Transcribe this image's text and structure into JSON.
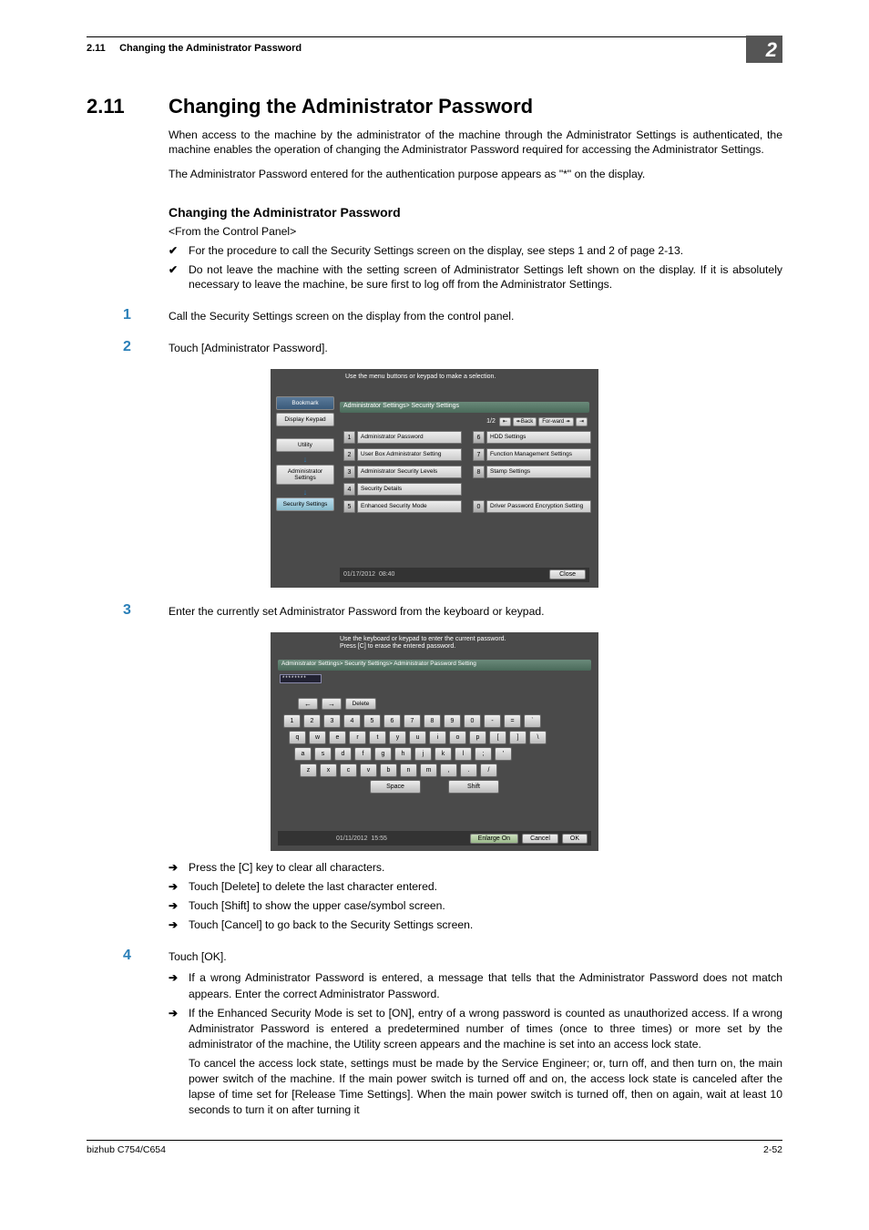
{
  "header": {
    "section_ref": "2.11",
    "section_name": "Changing the Administrator Password",
    "chapter_badge": "2"
  },
  "title": {
    "num": "2.11",
    "text": "Changing the Administrator Password"
  },
  "intro": {
    "p1": "When access to the machine by the administrator of the machine through the Administrator Settings is authenticated, the machine enables the operation of changing the Administrator Password required for accessing the Administrator Settings.",
    "p2": "The Administrator Password entered for the authentication purpose appears as \"*\" on the display."
  },
  "sub": {
    "heading": "Changing the Administrator Password",
    "from": "<From the Control Panel>"
  },
  "checks": [
    "For the procedure to call the Security Settings screen on the display, see steps 1 and 2 of page 2-13.",
    "Do not leave the machine with the setting screen of Administrator Settings left shown on the display. If it is absolutely necessary to leave the machine, be sure first to log off from the Administrator Settings."
  ],
  "steps": {
    "s1": {
      "num": "1",
      "text": "Call the Security Settings screen on the display from the control panel."
    },
    "s2": {
      "num": "2",
      "text": "Touch [Administrator Password]."
    },
    "s3": {
      "num": "3",
      "text": "Enter the currently set Administrator Password from the keyboard or keypad.",
      "arrows": [
        "Press the [C] key to clear all characters.",
        "Touch [Delete] to delete the last character entered.",
        "Touch [Shift] to show the upper case/symbol screen.",
        "Touch [Cancel] to go back to the Security Settings screen."
      ]
    },
    "s4": {
      "num": "4",
      "text": "Touch [OK].",
      "arrows": [
        "If a wrong Administrator Password is entered, a message that tells that the Administrator Password does not match appears. Enter the correct Administrator Password.",
        "If the Enhanced Security Mode is set to [ON], entry of a wrong password is counted as unauthorized access. If a wrong Administrator Password is entered a predetermined number of times (once to three times) or more set by the administrator of the machine, the Utility screen appears and the machine is set into an access lock state."
      ],
      "tail": "To cancel the access lock state, settings must be made by the Service Engineer; or, turn off, and then turn on, the main power switch of the machine. If the main power switch is turned off and on, the access lock state is canceled after the lapse of time set for [Release Time Settings]. When the main power switch is turned off, then on again, wait at least 10 seconds to turn it on after turning it"
    }
  },
  "ss1": {
    "topmsg": "Use the menu buttons or keypad to make a selection.",
    "crumb": "Administrator Settings> Security Settings",
    "page": "1/2",
    "back": "↞Back",
    "fwd": "For-ward ↠",
    "left": {
      "bookmark": "Bookmark",
      "keypad": "Display Keypad",
      "utility": "Utility",
      "admin": "Administrator Settings",
      "security": "Security Settings"
    },
    "leftcol": [
      {
        "n": "1",
        "l": "Administrator Password"
      },
      {
        "n": "2",
        "l": "User Box Administrator Setting"
      },
      {
        "n": "3",
        "l": "Administrator Security Levels"
      },
      {
        "n": "4",
        "l": "Security Details"
      },
      {
        "n": "5",
        "l": "Enhanced Security Mode"
      }
    ],
    "rightcol": [
      {
        "n": "6",
        "l": "HDD Settings"
      },
      {
        "n": "7",
        "l": "Function Management Settings"
      },
      {
        "n": "8",
        "l": "Stamp Settings"
      },
      {
        "n": "",
        "l": ""
      },
      {
        "n": "0",
        "l": "Driver Password Encryption Setting"
      }
    ],
    "date": "01/17/2012",
    "time": "08:40",
    "close": "Close"
  },
  "ss2": {
    "topmsg": "Use the keyboard or keypad to enter the current password.\nPress [C] to erase the entered password.",
    "crumb": "Administrator Settings> Security Settings> Administrator Password Setting",
    "pw": "********",
    "tb_left": "←",
    "tb_right": "→",
    "tb_del": "Delete",
    "rows": [
      [
        "1",
        "2",
        "3",
        "4",
        "5",
        "6",
        "7",
        "8",
        "9",
        "0",
        "-",
        "=",
        "`"
      ],
      [
        "q",
        "w",
        "e",
        "r",
        "t",
        "y",
        "u",
        "i",
        "o",
        "p",
        "[",
        "]",
        "\\"
      ],
      [
        "a",
        "s",
        "d",
        "f",
        "g",
        "h",
        "j",
        "k",
        "l",
        ";",
        "'"
      ],
      [
        "z",
        "x",
        "c",
        "v",
        "b",
        "n",
        "m",
        ",",
        ".",
        "/"
      ]
    ],
    "space": "Space",
    "shift": "Shift",
    "date": "01/11/2012",
    "time": "15:55",
    "enlarge": "Enlarge On",
    "cancel": "Cancel",
    "ok": "OK"
  },
  "footer": {
    "left": "bizhub C754/C654",
    "right": "2-52"
  }
}
